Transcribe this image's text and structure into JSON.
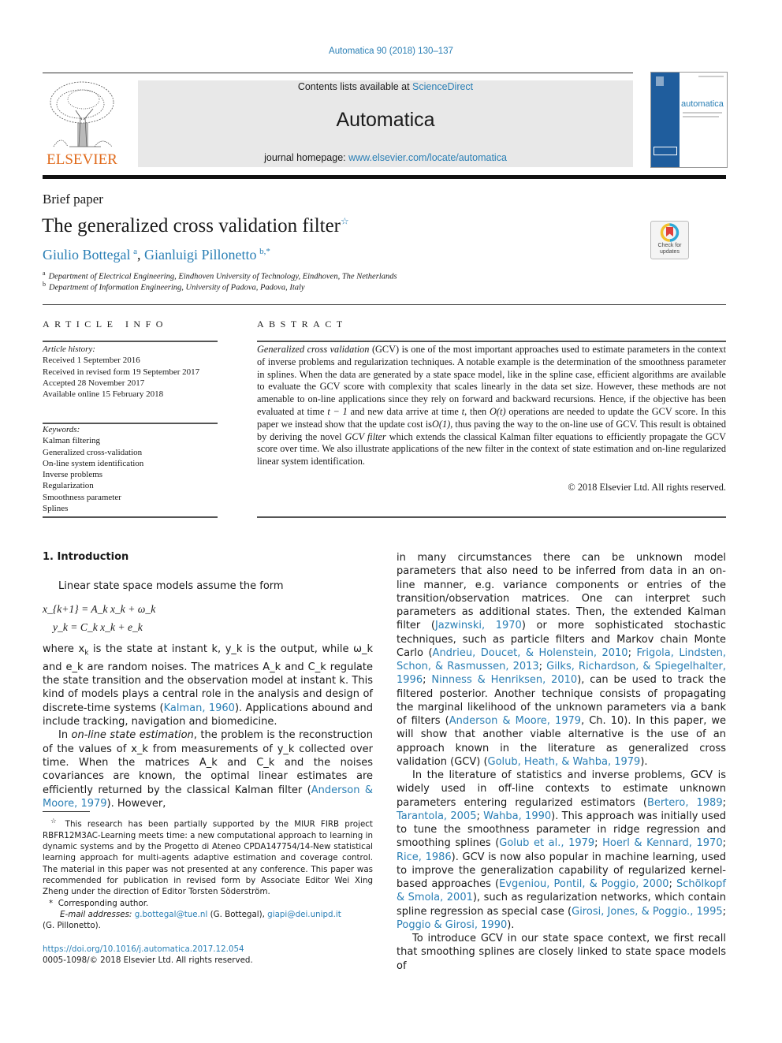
{
  "header": {
    "journal_ref": "Automatica 90 (2018) 130–137",
    "contents_prefix": "Contents lists available at ",
    "contents_link": "ScienceDirect",
    "journal_name": "Automatica",
    "homepage_prefix": "journal homepage: ",
    "homepage_link": "www.elsevier.com/locate/automatica",
    "publisher_logo": "ELSEVIER",
    "cover_title": "automatica"
  },
  "article": {
    "type": "Brief paper",
    "title": "The generalized cross validation filter",
    "title_mark": "☆",
    "crossmark": "Check for updates",
    "authors": [
      {
        "name": "Giulio Bottegal",
        "sup": "a"
      },
      {
        "name": "Gianluigi Pillonetto",
        "sup": "b,*"
      }
    ],
    "affiliations": [
      {
        "key": "a",
        "text": "Department of Electrical Engineering, Eindhoven University of Technology, Eindhoven, The Netherlands"
      },
      {
        "key": "b",
        "text": "Department of Information Engineering, University of Padova, Padova, Italy"
      }
    ]
  },
  "article_info": {
    "heading": "ARTICLE INFO",
    "history_label": "Article history:",
    "history": [
      "Received 1 September 2016",
      "Received in revised form 19 September 2017",
      "Accepted 28 November 2017",
      "Available online 15 February 2018"
    ],
    "keywords_label": "Keywords:",
    "keywords": [
      "Kalman filtering",
      "Generalized cross-validation",
      "On-line system identification",
      "Inverse problems",
      "Regularization",
      "Smoothness parameter",
      "Splines"
    ]
  },
  "abstract": {
    "heading": "ABSTRACT",
    "lead_italic": "Generalized cross validation",
    "text_1": " (GCV) is one of the most important approaches used to estimate parameters in the context of inverse problems and regularization techniques. A notable example is the determination of the smoothness parameter in splines. When the data are generated by a state space model, like in the spline case, efficient algorithms are available to evaluate the GCV score with complexity that scales linearly in the data set size. However, these methods are not amenable to on-line applications since they rely on forward and backward recursions. Hence, if the objective has been evaluated at time ",
    "math_1": "t − 1",
    "text_2": " and new data arrive at time ",
    "math_2": "t",
    "text_3": ", then ",
    "math_3": "O(t)",
    "text_4": " operations are needed to update the GCV score. In this paper we instead show that the update cost is",
    "math_4": "O(1)",
    "text_5": ", thus paving the way to the on-line use of GCV. This result is obtained by deriving the novel ",
    "italic_2": "GCV filter",
    "text_6": " which extends the classical Kalman filter equations to efficiently propagate the GCV score over time. We also illustrate applications of the new filter in the context of state estimation and on-line regularized linear system identification.",
    "copyright": "© 2018 Elsevier Ltd. All rights reserved."
  },
  "body": {
    "section_heading": "1.  Introduction",
    "intro_line": "Linear state space models assume the form",
    "equations": [
      "x_{k+1} = A_k x_k + ω_k",
      "y_k = C_k x_k + e_k"
    ],
    "left_p1_a": "where x",
    "left_p1": " is the state at instant k, y_k is the output, while ω_k and e_k are random noises. The matrices A_k and C_k regulate the state transition and the observation model at instant k. This kind of models plays a central role in the analysis and design of discrete-time systems (",
    "cite_kalman": "Kalman, 1960",
    "left_p1_end": "). Applications abound and include tracking, navigation and biomedicine.",
    "left_p2_pre": "In ",
    "left_p2_it": "on-line state estimation",
    "left_p2": ", the problem is the reconstruction of the values of x_k from measurements of y_k collected over time. When the matrices A_k and C_k and the noises covariances are known, the optimal linear estimates are efficiently returned by the classical Kalman filter (",
    "cite_anderson": "Anderson & Moore, 1979",
    "left_p2_end": "). However,",
    "right_p1_a": "in many circumstances there can be unknown model parameters that also need to be inferred from data in an on-line manner, e.g. variance components or entries of the transition/observation matrices. One can interpret such parameters as additional states. Then, the extended Kalman filter (",
    "cite_jaz": "Jazwinski, 1970",
    "right_p1_b": ") or more sophisticated stochastic techniques, such as particle filters and Markov chain Monte Carlo (",
    "cite_andrieu": "Andrieu, Doucet, & Holenstein, 2010",
    "cite_frigola": "Frigola, Lindsten, Schon, & Rasmussen, 2013",
    "cite_gilks": "Gilks, Richardson, & Spiegelhalter, 1996",
    "cite_ninness": "Ninness & Henriksen, 2010",
    "right_p1_c": "), can be used to track the filtered posterior. Another technique consists of propagating the marginal likelihood of the unknown parameters via a bank of filters (",
    "cite_anderson2": "Anderson & Moore, 1979",
    "right_p1_d": ", Ch. 10). In this paper, we will show that another viable alternative is the use of an approach known in the literature as generalized cross validation (GCV) (",
    "cite_golub": "Golub, Heath, & Wahba, 1979",
    "right_p1_e": ").",
    "right_p2_a": "In the literature of statistics and inverse problems, GCV is widely used in off-line contexts to estimate unknown parameters entering regularized estimators (",
    "cite_bertero": "Bertero, 1989",
    "cite_tarantola": "Tarantola, 2005",
    "cite_wahba": "Wahba, 1990",
    "right_p2_b": "). This approach was initially used to tune the smoothness parameter in ridge regression and smoothing splines (",
    "cite_golub2": "Golub et al., 1979",
    "cite_hoerl": "Hoerl & Kennard, 1970",
    "cite_rice": "Rice, 1986",
    "right_p2_c": "). GCV is now also popular in machine learning, used to improve the generalization capability of regularized kernel-based approaches (",
    "cite_evg": "Evgeniou, Pontil, & Poggio, 2000",
    "cite_scholkopf": "Schölkopf & Smola, 2001",
    "right_p2_d": "), such as regularization networks, which contain spline regression as special case (",
    "cite_girosi": "Girosi, Jones, & Poggio., 1995",
    "cite_poggio": "Poggio & Girosi, 1990",
    "right_p2_e": ").",
    "right_p3": "To introduce GCV in our state space context, we first recall that smoothing splines are closely linked to state space models of",
    "sep": "; "
  },
  "footnotes": {
    "star_mark": "☆",
    "funding": "This research has been partially supported by the MIUR FIRB project RBFR12M3AC-Learning meets time: a new computational approach to learning in dynamic systems and by the Progetto di Ateneo CPDA147754/14-New statistical learning approach for multi-agents adaptive estimation and coverage control. The material in this paper was not presented at any conference. This paper was recommended for publication in revised form by Associate Editor Wei Xing Zheng under the direction of Editor Torsten Söderström.",
    "corr_mark": "*",
    "corr": "Corresponding author.",
    "email_label": "E-mail addresses:",
    "email1": "g.bottegal@tue.nl",
    "email1_owner": " (G. Bottegal), ",
    "email2": "giapi@dei.unipd.it",
    "email2_owner": "(G. Pillonetto).",
    "doi": "https://doi.org/10.1016/j.automatica.2017.12.054",
    "issn": "0005-1098/© 2018 Elsevier Ltd. All rights reserved."
  }
}
